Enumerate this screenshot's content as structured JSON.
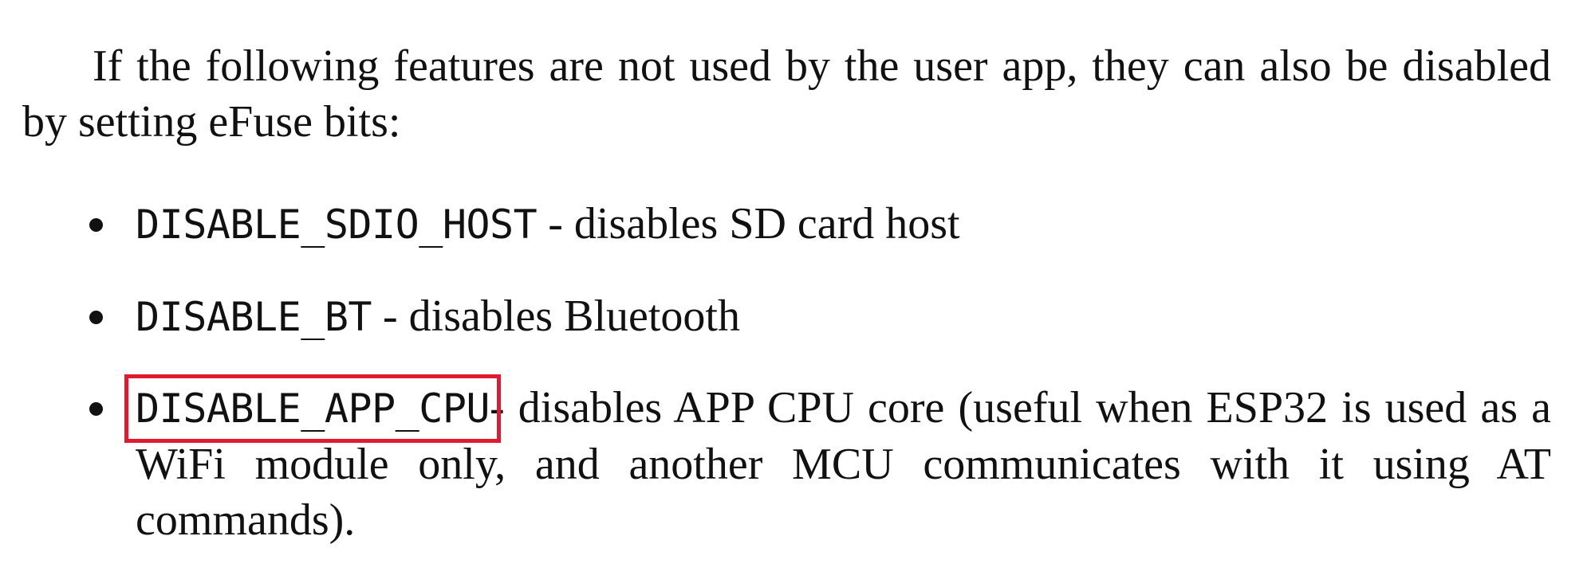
{
  "intro": {
    "text": "If the following features are not used by the user app, they can also be disabled by setting eFuse bits:"
  },
  "features": [
    {
      "flag": "DISABLE_SDIO_HOST",
      "description": " - disables SD card host"
    },
    {
      "flag": "DISABLE_BT",
      "description": " - disables Bluetooth"
    },
    {
      "flag": "DISABLE_APP_CPU",
      "description": "- disables APP CPU core (useful when ESP32 is used as a WiFi module only, and another MCU communicates with it using AT commands).",
      "highlighted": true
    }
  ],
  "highlight_color": "#e01b2f"
}
